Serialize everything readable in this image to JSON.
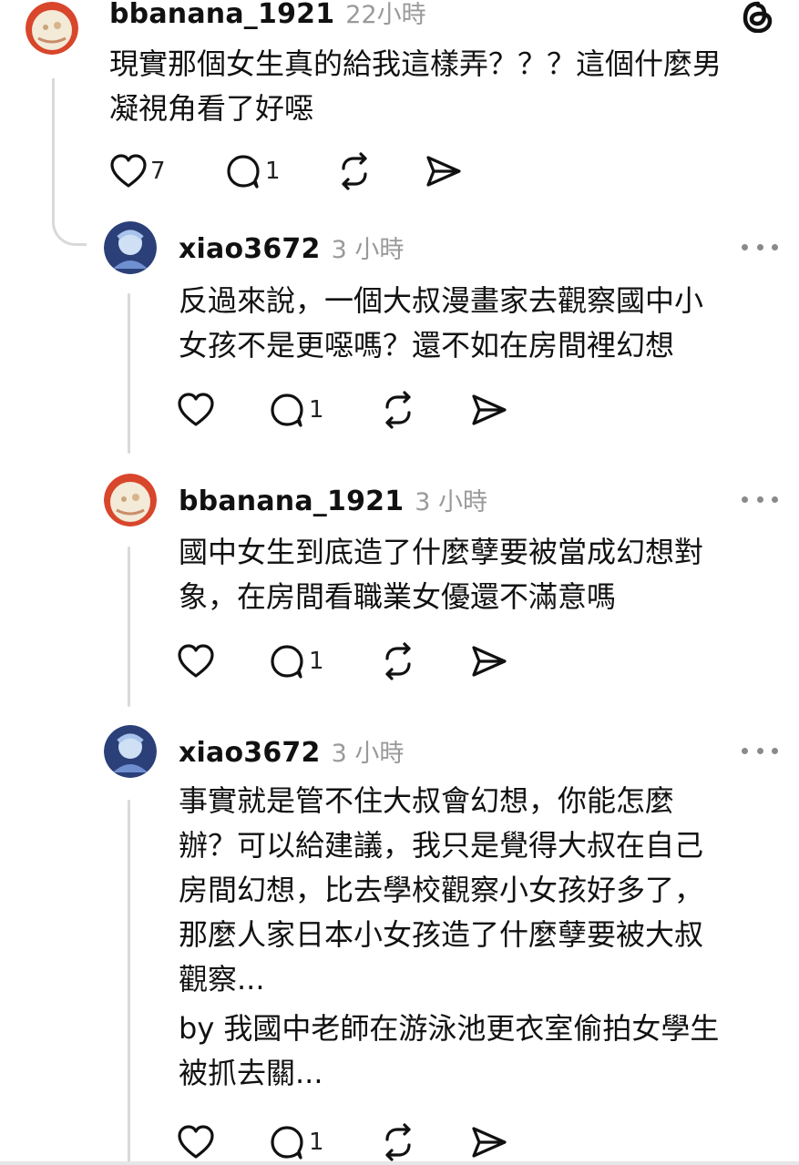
{
  "app": {
    "logo_icon": "threads-logo-icon"
  },
  "posts": [
    {
      "username": "bbanana_1921",
      "time": "22小時",
      "text": [
        "現實那個女生真的給我這樣弄？？？這個什麼男",
        "凝視角看了好噁"
      ],
      "likes": "7",
      "replies": "1"
    },
    {
      "username": "xiao3672",
      "time": "3 小時",
      "text": [
        "反過來說，一個大叔漫畫家去觀察國中小",
        "女孩不是更噁嗎？還不如在房間裡幻想"
      ],
      "likes": "",
      "replies": "1"
    },
    {
      "username": "bbanana_1921",
      "time": "3 小時",
      "text": [
        "國中女生到底造了什麼孽要被當成幻想對",
        "象，在房間看職業女優還不滿意嗎"
      ],
      "likes": "",
      "replies": "1"
    },
    {
      "username": "xiao3672",
      "time": "3 小時",
      "text": [
        "事實就是管不住大叔會幻想，你能怎麼",
        "辦？可以給建議，我只是覺得大叔在自己",
        "房間幻想，比去學校觀察小女孩好多了，",
        "那麼人家日本小女孩造了什麼孽要被大叔",
        "觀察..."
      ],
      "text2": [
        "by 我國中老師在游泳池更衣室偷拍女學生",
        "被抓去關..."
      ],
      "likes": "",
      "replies": "1"
    }
  ]
}
